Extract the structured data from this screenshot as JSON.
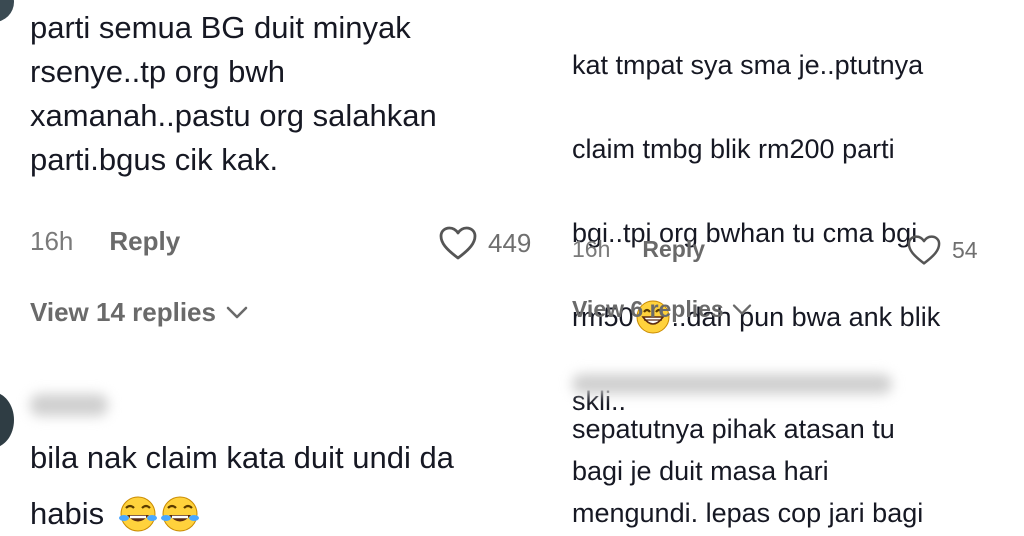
{
  "left_panel": {
    "comment1": {
      "text": "parti semua BG duit minyak\nrsenye..tp org bwh\nxamanah..pastu org salahkan\nparti.bgus cik kak.",
      "time": "16h",
      "reply_label": "Reply",
      "likes": "449",
      "view_replies": "View 14 replies"
    },
    "comment2": {
      "text_line1": "bila nak claim kata duit undi da",
      "text_line2": "habis",
      "emojis": [
        "face-with-tears-of-joy",
        "face-with-tears-of-joy"
      ]
    }
  },
  "right_panel": {
    "comment1": {
      "text_lines": [
        "kat tmpat sya sma je..ptutnya",
        "claim tmbg blik rm200 parti",
        "bgi..tpi org bwhan tu cma bgi"
      ],
      "text_line4_pre": "rm50",
      "text_line4_post": "..dah pun bwa ank blik",
      "text_line5": "skli..",
      "emoji": "grinning-face",
      "time": "16h",
      "reply_label": "Reply",
      "likes": "54",
      "view_replies": "View 6 replies"
    },
    "comment2": {
      "text": "sepatutnya pihak atasan tu\nbagi je duit masa hari\nmengundi. lepas cop jari bagi"
    }
  },
  "colors": {
    "text": "#161823",
    "muted": "#6a6a6a",
    "background": "#ffffff"
  }
}
